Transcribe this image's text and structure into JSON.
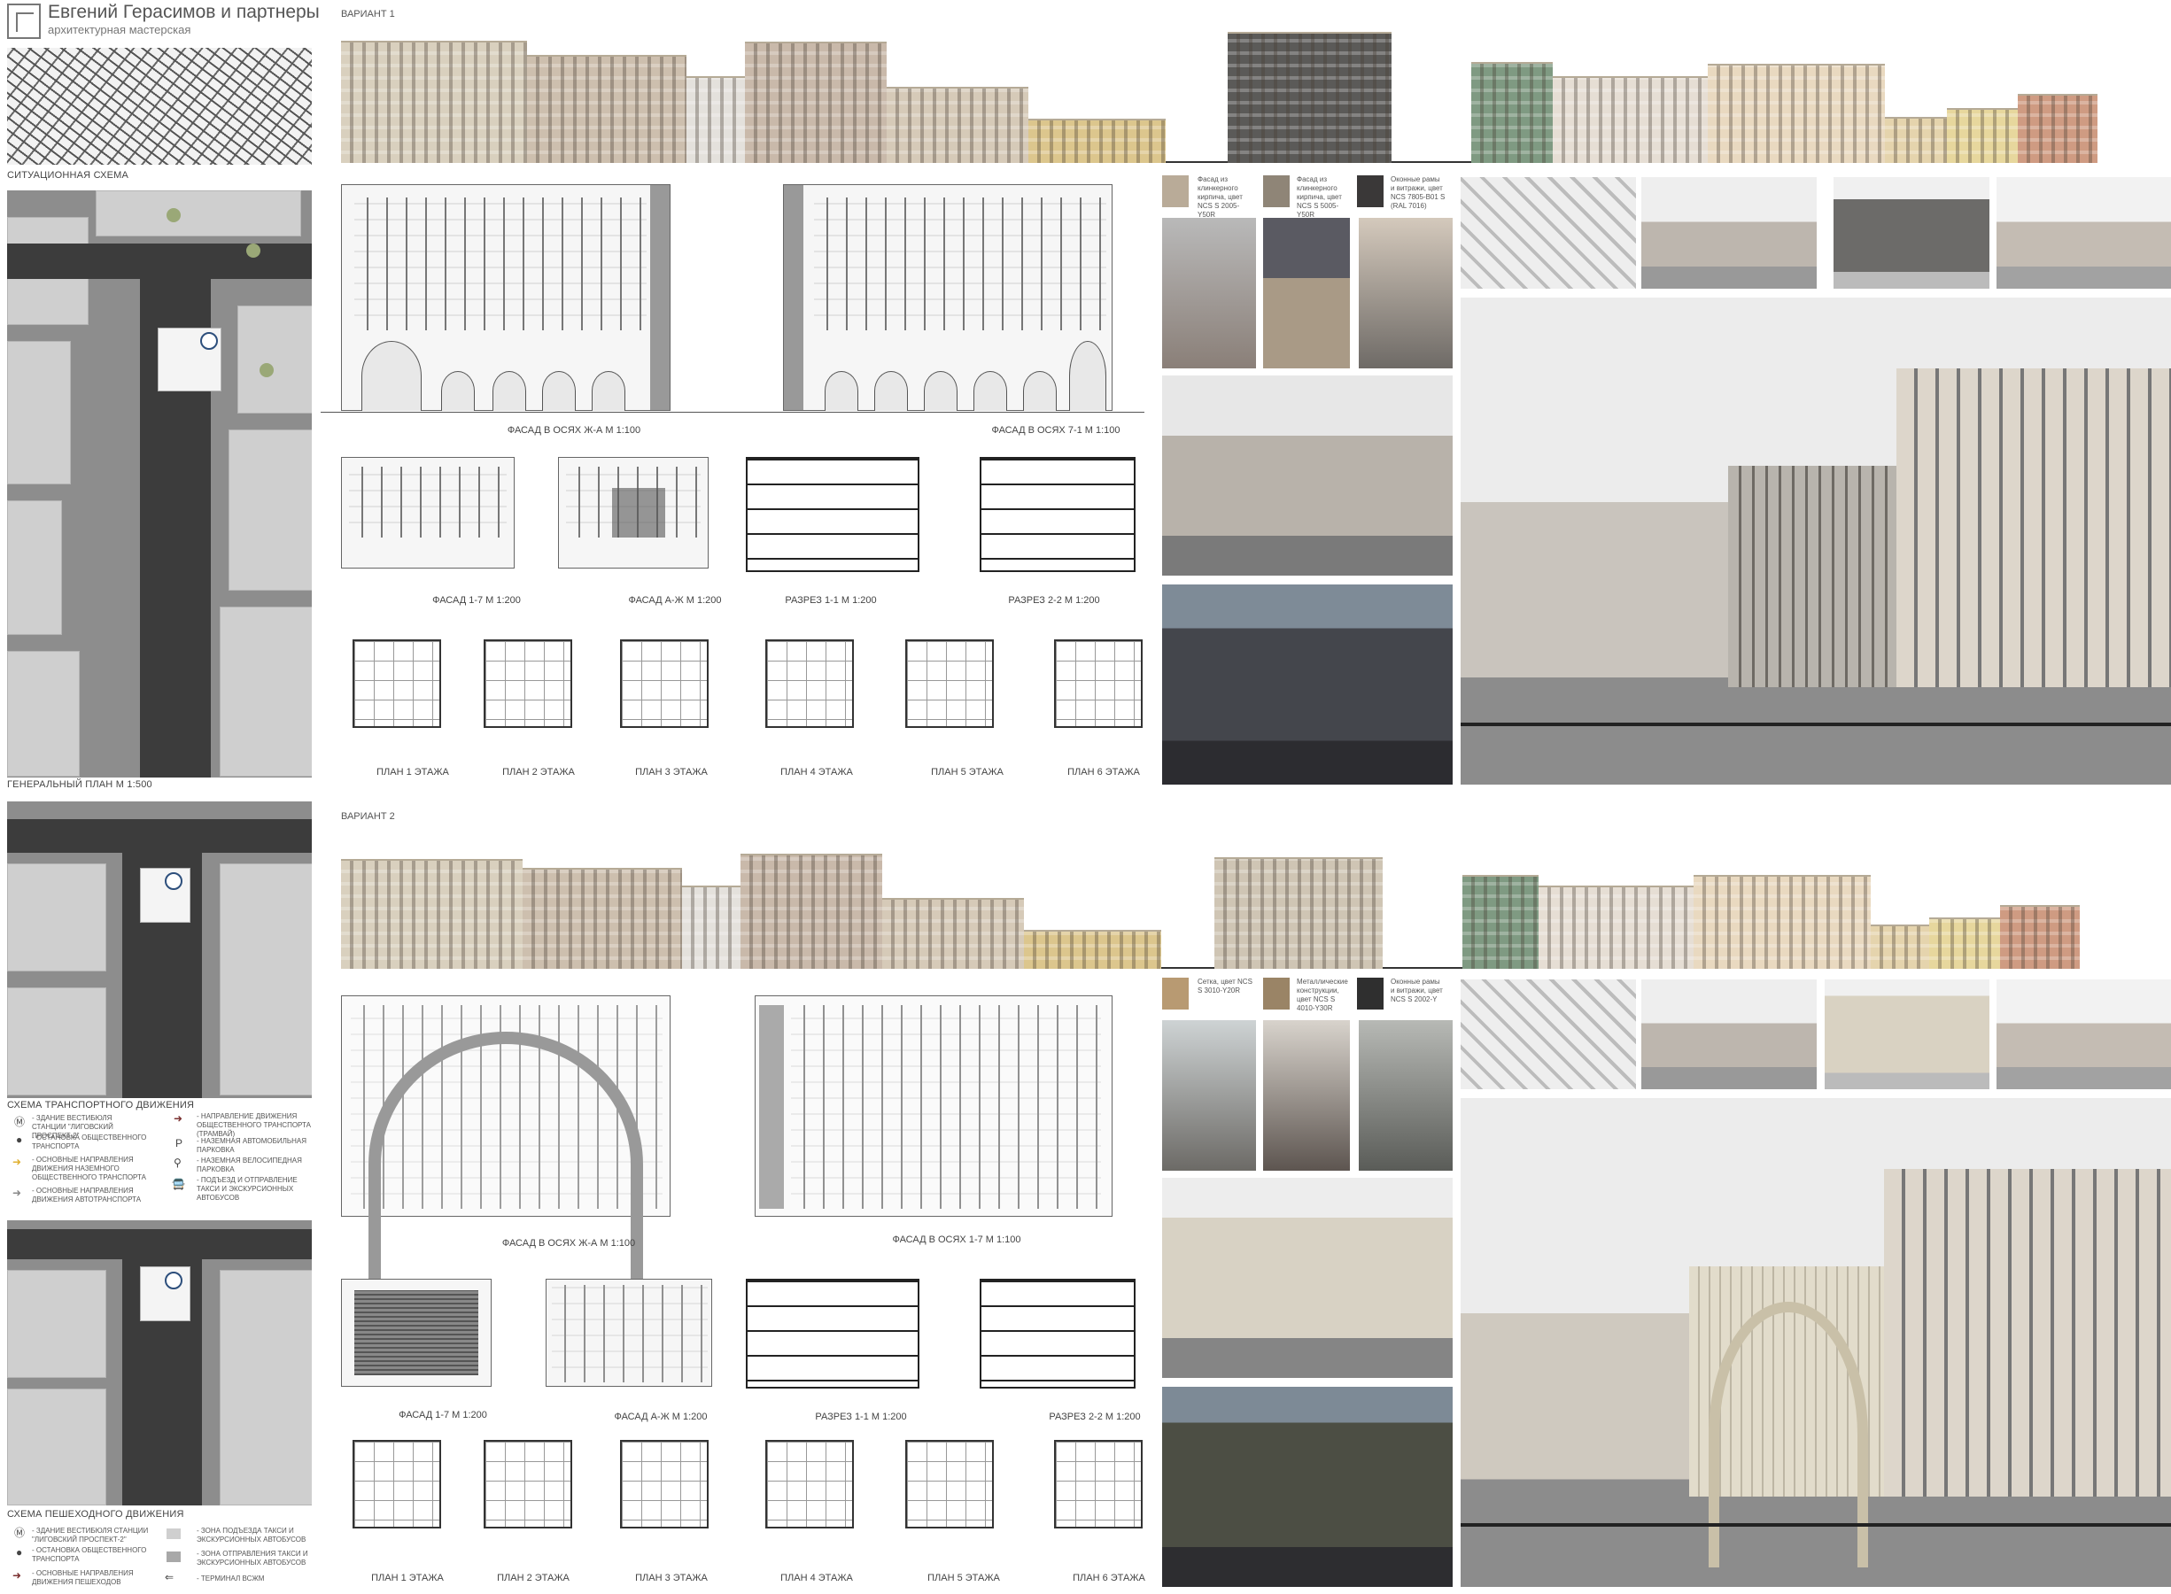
{
  "firm": {
    "name": "Евгений Герасимов и партнеры",
    "subtitle": "архитектурная мастерская"
  },
  "left_column": {
    "situation_label": "СИТУАЦИОННАЯ СХЕМА",
    "master_plan_label": "ГЕНЕРАЛЬНЫЙ ПЛАН М 1:500",
    "transport_label": "СХЕМА ТРАНСПОРТНОГО ДВИЖЕНИЯ",
    "pedestrian_label": "СХЕМА ПЕШЕХОДНОГО ДВИЖЕНИЯ",
    "transport_legend": [
      "- ЗДАНИЕ ВЕСТИБЮЛЯ СТАНЦИИ \"ЛИГОВСКИЙ ПРОСПЕКТ-2\"",
      "- ОСТАНОВКА ОБЩЕСТВЕННОГО ТРАНСПОРТА",
      "- ОСНОВНЫЕ НАПРАВЛЕНИЯ ДВИЖЕНИЯ НАЗЕМНОГО ОБЩЕСТВЕННОГО ТРАНСПОРТА",
      "- ОСНОВНЫЕ НАПРАВЛЕНИЯ ДВИЖЕНИЯ АВТОТРАНСПОРТА",
      "- НАПРАВЛЕНИЕ ДВИЖЕНИЯ ОБЩЕСТВЕННОГО ТРАНСПОРТА (ТРАМВАЙ)",
      "- НАЗЕМНАЯ АВТОМОБИЛЬНАЯ ПАРКОВКА",
      "- НАЗЕМНАЯ ВЕЛОСИПЕДНАЯ ПАРКОВКА",
      "- ПОДЪЕЗД И ОТПРАВЛЕНИЕ ТАКСИ И ЭКСКУРСИОННЫХ АВТОБУСОВ"
    ],
    "pedestrian_legend": [
      "- ЗДАНИЕ ВЕСТИБЮЛЯ СТАНЦИИ \"ЛИГОВСКИЙ ПРОСПЕКТ-2\"",
      "- ОСТАНОВКА ОБЩЕСТВЕННОГО ТРАНСПОРТА",
      "- ОСНОВНЫЕ НАПРАВЛЕНИЯ ДВИЖЕНИЯ ПЕШЕХОДОВ",
      "- ЗОНА ПОДЪЕЗДА ТАКСИ И ЭКСКУРСИОННЫХ АВТОБУСОВ",
      "- ЗОНА ОТПРАВЛЕНИЯ ТАКСИ И ЭКСКУРСИОННЫХ АВТОБУСОВ",
      "- ТЕРМИНАЛ ВСЖМ"
    ]
  },
  "variant1": {
    "title": "ВАРИАНТ 1",
    "main_facades": [
      "ФАСАД В ОСЯХ Ж-А М 1:100",
      "ФАСАД В ОСЯХ 7-1 М 1:100"
    ],
    "drawings": [
      "ФАСАД 1-7 М 1:200",
      "ФАСАД А-Ж М 1:200",
      "РАЗРЕЗ 1-1 М 1:200",
      "РАЗРЕЗ 2-2 М 1:200"
    ],
    "plans": [
      "ПЛАН 1 ЭТАЖА",
      "ПЛАН 2 ЭТАЖА",
      "ПЛАН 3 ЭТАЖА",
      "ПЛАН 4 ЭТАЖА",
      "ПЛАН 5 ЭТАЖА",
      "ПЛАН 6 ЭТАЖА"
    ],
    "materials": [
      {
        "label": "Фасад из клинкерного кирпича, цвет NCS S 2005-Y50R",
        "color": "#b9ab98"
      },
      {
        "label": "Фасад из клинкерного кирпича, цвет NCS S 5005-Y50R",
        "color": "#8f8577"
      },
      {
        "label": "Оконные рамы и витражи, цвет NCS 7805-B01 S (RAL 7016)",
        "color": "#3a3838"
      }
    ]
  },
  "variant2": {
    "title": "ВАРИАНТ 2",
    "main_facades": [
      "ФАСАД В ОСЯХ Ж-А М 1:100",
      "ФАСАД В ОСЯХ 1-7 М 1:100"
    ],
    "drawings": [
      "ФАСАД 1-7 М 1:200",
      "ФАСАД А-Ж М 1:200",
      "РАЗРЕЗ 1-1 М 1:200",
      "РАЗРЕЗ 2-2 М 1:200"
    ],
    "plans": [
      "ПЛАН 1 ЭТАЖА",
      "ПЛАН 2 ЭТАЖА",
      "ПЛАН 3 ЭТАЖА",
      "ПЛАН 4 ЭТАЖА",
      "ПЛАН 5 ЭТАЖА",
      "ПЛАН 6 ЭТАЖА"
    ],
    "materials": [
      {
        "label": "Сетка, цвет NCS S 3010-Y20R",
        "color": "#b89a72"
      },
      {
        "label": "Металлические конструкции, цвет NCS S 4010-Y30R",
        "color": "#9a8466"
      },
      {
        "label": "Оконные рамы и витражи, цвет NCS S 2002-Y",
        "color": "#2f2f2f"
      }
    ]
  }
}
